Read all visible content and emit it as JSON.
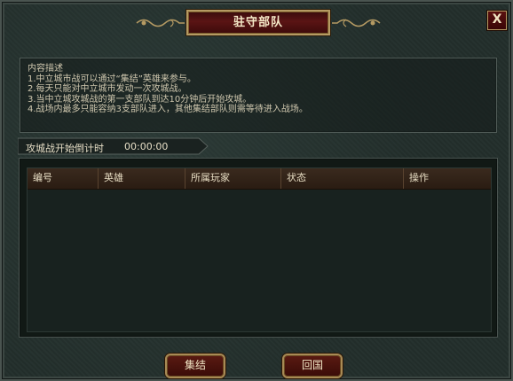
{
  "window": {
    "title": "驻守部队",
    "close_label": "X"
  },
  "description": {
    "heading": "内容描述",
    "lines": [
      "1.中立城市战可以通过“集结”英雄来参与。",
      "2.每天只能对中立城市发动一次攻城战。",
      "3.当中立城攻城战的第一支部队到达10分钟后开始攻城。",
      "4.战场内最多只能容纳3支部队进入，其他集结部队则需等待进入战场。"
    ]
  },
  "countdown": {
    "label": "攻城战开始倒计时",
    "time": "00:00:00"
  },
  "table": {
    "headers": [
      "编号",
      "英雄",
      "所属玩家",
      "状态",
      "操作"
    ],
    "rows": []
  },
  "buttons": {
    "gather": "集结",
    "return_home": "回国"
  },
  "colors": {
    "title_plaque": "#5a1414",
    "gold_border": "#b59a63",
    "panel_bg": "#243230"
  }
}
